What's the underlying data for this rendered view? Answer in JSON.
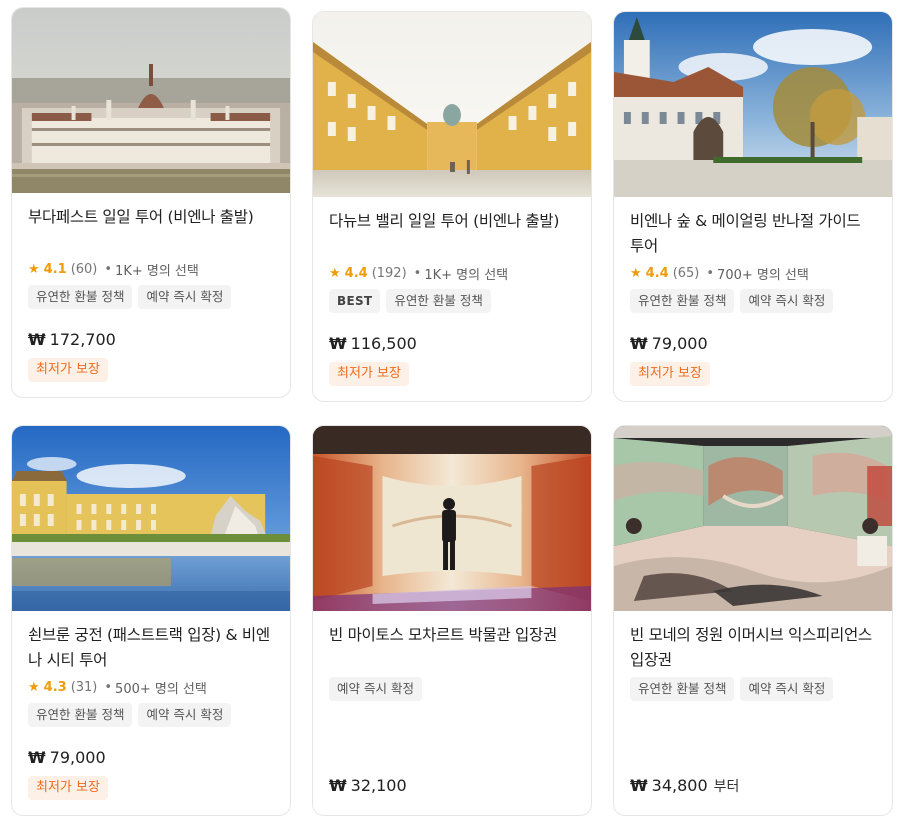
{
  "currency_symbol": "₩",
  "cards": [
    {
      "title": "부다페스트 일일 투어 (비엔나 출발)",
      "image": "budapest-parliament-photo",
      "rating": "4.1",
      "reviews": "(60)",
      "bookings": "1K+ 명의 선택",
      "badges": [
        "유연한 환불 정책",
        "예약 즉시 확정"
      ],
      "price": "172,700",
      "guarantee": "최저가 보장"
    },
    {
      "title": "다뉴브 밸리 일일 투어 (비엔나 출발)",
      "image": "melk-abbey-courtyard-photo",
      "rating": "4.4",
      "reviews": "(192)",
      "bookings": "1K+ 명의 선택",
      "best": "BEST",
      "badges": [
        "유연한 환불 정책"
      ],
      "price": "116,500",
      "guarantee": "최저가 보장"
    },
    {
      "title": "비엔나 숲 & 메이얼링 반나절 가이드 투어",
      "image": "heiligenkreuz-abbey-photo",
      "rating": "4.4",
      "reviews": "(65)",
      "bookings": "700+ 명의 선택",
      "badges": [
        "유연한 환불 정책",
        "예약 즉시 확정"
      ],
      "price": "79,000",
      "guarantee": "최저가 보장"
    },
    {
      "title": "쇤브룬 궁전 (패스트트랙 입장) & 비엔나 시티 투어",
      "image": "schonbrunn-palace-photo",
      "rating": "4.3",
      "reviews": "(31)",
      "bookings": "500+ 명의 선택",
      "badges": [
        "유연한 환불 정책",
        "예약 즉시 확정"
      ],
      "price": "79,000",
      "guarantee": "최저가 보장"
    },
    {
      "title": "빈 마이토스 모차르트 박물관 입장권",
      "image": "mythos-mozart-immersive-room-photo",
      "badges": [
        "예약 즉시 확정"
      ],
      "price": "32,100"
    },
    {
      "title": "빈 모네의 정원 이머시브 익스피리언스 입장권",
      "image": "monet-garden-immersive-photo",
      "badges": [
        "유연한 환불 정책",
        "예약 즉시 확정"
      ],
      "price": "34,800",
      "price_suffix": "부터"
    }
  ]
}
